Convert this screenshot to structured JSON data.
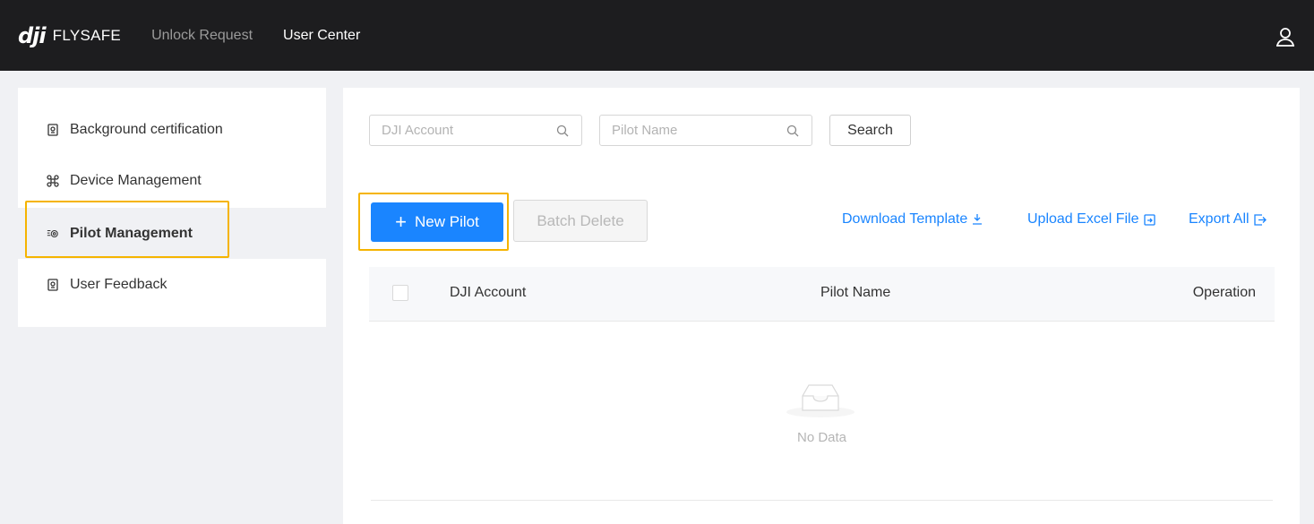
{
  "header": {
    "logo_mark": "dji",
    "logo_text": "FLYSAFE",
    "nav": [
      {
        "label": "Unlock Request",
        "active": false
      },
      {
        "label": "User Center",
        "active": true
      }
    ],
    "user_icon": "user-icon"
  },
  "sidebar": {
    "items": [
      {
        "label": "Background certification",
        "icon": "certificate-icon",
        "active": false
      },
      {
        "label": "Device Management",
        "icon": "drone-icon",
        "active": false
      },
      {
        "label": "Pilot Management",
        "icon": "pilot-icon",
        "active": true
      },
      {
        "label": "User Feedback",
        "icon": "feedback-icon",
        "active": false
      }
    ]
  },
  "filters": {
    "account_placeholder": "DJI Account",
    "account_value": "",
    "pilot_placeholder": "Pilot Name",
    "pilot_value": "",
    "search_label": "Search"
  },
  "actions": {
    "new_pilot_label": "New Pilot",
    "batch_delete_label": "Batch Delete",
    "download_template_label": "Download Template",
    "upload_excel_label": "Upload Excel File",
    "export_all_label": "Export All"
  },
  "table": {
    "columns": [
      "DJI Account",
      "Pilot Name",
      "Operation"
    ],
    "rows": [],
    "empty_text": "No Data"
  },
  "colors": {
    "accent": "#1a85ff",
    "highlight": "#f5b400",
    "topbar": "#1d1d1f"
  }
}
